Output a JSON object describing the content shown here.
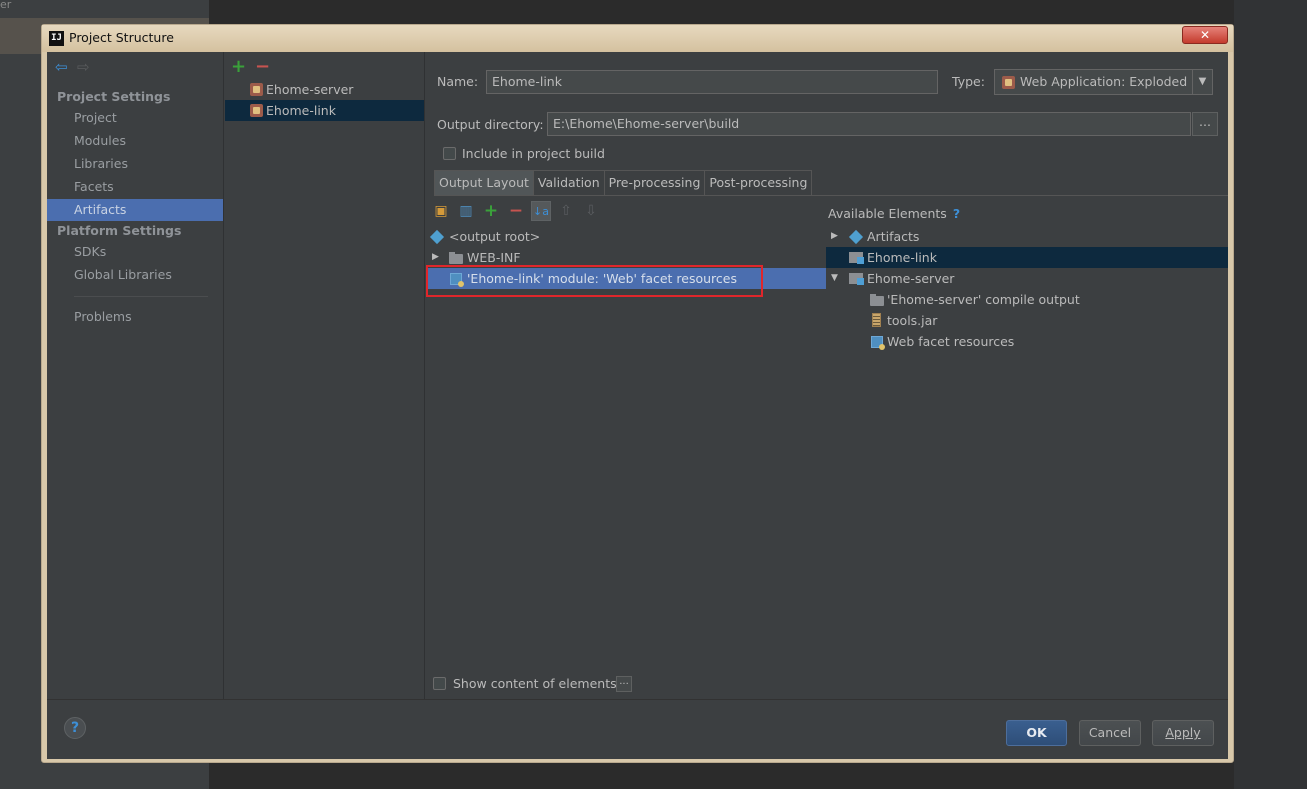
{
  "background": {
    "left_fragment": "er"
  },
  "window": {
    "title": "Project Structure",
    "app_icon": "IJ",
    "close": "✕"
  },
  "sidebar": {
    "project_settings": "Project Settings",
    "project_items": [
      "Project",
      "Modules",
      "Libraries",
      "Facets",
      "Artifacts"
    ],
    "selected": "Artifacts",
    "platform_settings": "Platform Settings",
    "platform_items": [
      "SDKs",
      "Global Libraries"
    ],
    "problems": "Problems"
  },
  "artifacts": {
    "add": "+",
    "remove": "−",
    "items": [
      "Ehome-server",
      "Ehome-link"
    ],
    "selected": "Ehome-link"
  },
  "form": {
    "name_label": "Name:",
    "name_value": "Ehome-link",
    "type_label": "Type:",
    "type_value": "Web Application: Exploded",
    "output_label": "Output directory:",
    "output_value": "E:\\Ehome\\Ehome-server\\build",
    "browse": "...",
    "include_build": "Include in project build",
    "include_build_checked": false
  },
  "tabs": [
    "Output Layout",
    "Validation",
    "Pre-processing",
    "Post-processing"
  ],
  "active_tab": "Output Layout",
  "output_layout": {
    "tree": [
      {
        "label": "<output root>",
        "icon": "output-root-icon"
      },
      {
        "label": "WEB-INF",
        "icon": "folder-icon",
        "expandable": true
      },
      {
        "label": "'Ehome-link' module: 'Web' facet resources",
        "icon": "web-resources-icon",
        "selected": true
      }
    ],
    "show_content": "Show content of elements",
    "show_content_checked": false,
    "show_content_btn": "..."
  },
  "available": {
    "title": "Available Elements",
    "help": "?",
    "tree": [
      {
        "label": "Artifacts",
        "icon": "artifacts-icon",
        "arrow": "▶",
        "depth": 0
      },
      {
        "label": "Ehome-link",
        "icon": "module-icon",
        "depth": 0,
        "selected": true
      },
      {
        "label": "Ehome-server",
        "icon": "module-icon",
        "arrow": "▼",
        "depth": 0
      },
      {
        "label": "'Ehome-server' compile output",
        "icon": "compile-output-icon",
        "depth": 1
      },
      {
        "label": "tools.jar",
        "icon": "jar-icon",
        "depth": 1
      },
      {
        "label": "Web facet resources",
        "icon": "web-resources-icon",
        "depth": 1
      }
    ]
  },
  "buttons": {
    "ok": "OK",
    "cancel": "Cancel",
    "apply": "Apply",
    "help": "?"
  },
  "colors": {
    "selection": "#4b6eaf",
    "highlight_box": "#e0262b",
    "accent": "#3d8fd6"
  }
}
